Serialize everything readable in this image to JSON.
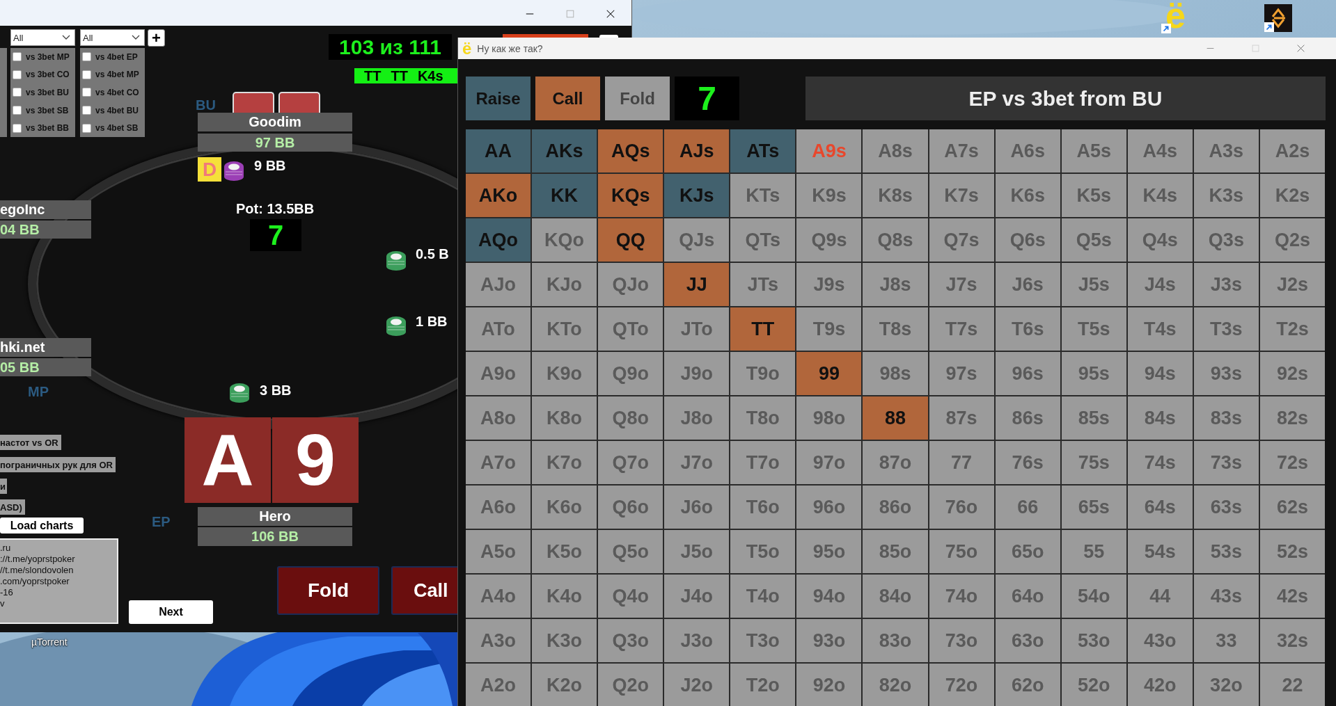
{
  "poker_window": {
    "dropdowns": [
      {
        "value": "All"
      },
      {
        "value": "All"
      }
    ],
    "add_button": "+",
    "checkbox_columns": [
      [
        {
          "label": "vs 3bet MP",
          "checked": false
        },
        {
          "label": "vs 3bet CO",
          "checked": false
        },
        {
          "label": "vs 3bet BU",
          "checked": false
        },
        {
          "label": "vs 3bet SB",
          "checked": false
        },
        {
          "label": "vs 3bet BB",
          "checked": false
        }
      ],
      [
        {
          "label": "vs 4bet EP",
          "checked": false
        },
        {
          "label": "vs 4bet MP",
          "checked": false
        },
        {
          "label": "vs 4bet CO",
          "checked": false
        },
        {
          "label": "vs 4bet BU",
          "checked": false
        },
        {
          "label": "vs 4bet SB",
          "checked": false
        }
      ]
    ],
    "counter": "103 из 111",
    "history": [
      "TT",
      "TT",
      "K4s"
    ],
    "seats": [
      {
        "position": "BU",
        "name": "Goodim",
        "stack": "97 BB"
      },
      {
        "name": "egoInc",
        "stack": "04 BB"
      },
      {
        "position": "MP",
        "name": "hki.net",
        "stack": "05 BB"
      },
      {
        "position": "EP",
        "name": "Hero",
        "stack": "106 BB"
      }
    ],
    "dealer": "D",
    "hero_cards": [
      "A",
      "9"
    ],
    "pot": "Pot: 13.5BB",
    "count": "7",
    "bets": [
      {
        "amount": "9 BB",
        "color": "#9b3fb5"
      },
      {
        "amount": "0.5 B",
        "color": "#3c9e5c"
      },
      {
        "amount": "1 BB",
        "color": "#3c9e5c"
      },
      {
        "amount": "3 BB",
        "color": "#3c9e5c"
      }
    ],
    "side_labels": [
      "настот vs OR",
      "пограничных рук для OR",
      "и",
      "ASD)"
    ],
    "load_button": "Load charts",
    "info_lines": [
      ".ru",
      "://t.me/yoprstpoker",
      "//t.me/slondovolen",
      ".com/yoprstpoker",
      "-16",
      "v"
    ],
    "next_button": "Next",
    "actions": [
      "Fold",
      "Call"
    ]
  },
  "chart_window": {
    "title": "Ну как же так?",
    "app_icon": "ё",
    "legend": [
      {
        "label": "Raise",
        "kind": "raise"
      },
      {
        "label": "Call",
        "kind": "call"
      },
      {
        "label": "Fold",
        "kind": "fold"
      }
    ],
    "count": "7",
    "heading": "EP vs 3bet from BU",
    "grid": [
      [
        {
          "label": "AA",
          "kind": "raise",
          "highlighted": false
        },
        {
          "label": "AKs",
          "kind": "raise",
          "highlighted": false
        },
        {
          "label": "AQs",
          "kind": "call",
          "highlighted": false
        },
        {
          "label": "AJs",
          "kind": "call",
          "highlighted": false
        },
        {
          "label": "ATs",
          "kind": "raise",
          "highlighted": false
        },
        {
          "label": "A9s",
          "kind": "fold",
          "highlighted": true
        },
        {
          "label": "A8s",
          "kind": "fold",
          "highlighted": false
        },
        {
          "label": "A7s",
          "kind": "fold",
          "highlighted": false
        },
        {
          "label": "A6s",
          "kind": "fold",
          "highlighted": false
        },
        {
          "label": "A5s",
          "kind": "fold",
          "highlighted": false
        },
        {
          "label": "A4s",
          "kind": "fold",
          "highlighted": false
        },
        {
          "label": "A3s",
          "kind": "fold",
          "highlighted": false
        },
        {
          "label": "A2s",
          "kind": "fold",
          "highlighted": false
        }
      ],
      [
        {
          "label": "AKo",
          "kind": "call",
          "highlighted": false
        },
        {
          "label": "KK",
          "kind": "raise",
          "highlighted": false
        },
        {
          "label": "KQs",
          "kind": "call",
          "highlighted": false
        },
        {
          "label": "KJs",
          "kind": "raise",
          "highlighted": false
        },
        {
          "label": "KTs",
          "kind": "fold",
          "highlighted": false
        },
        {
          "label": "K9s",
          "kind": "fold",
          "highlighted": false
        },
        {
          "label": "K8s",
          "kind": "fold",
          "highlighted": false
        },
        {
          "label": "K7s",
          "kind": "fold",
          "highlighted": false
        },
        {
          "label": "K6s",
          "kind": "fold",
          "highlighted": false
        },
        {
          "label": "K5s",
          "kind": "fold",
          "highlighted": false
        },
        {
          "label": "K4s",
          "kind": "fold",
          "highlighted": false
        },
        {
          "label": "K3s",
          "kind": "fold",
          "highlighted": false
        },
        {
          "label": "K2s",
          "kind": "fold",
          "highlighted": false
        }
      ],
      [
        {
          "label": "AQo",
          "kind": "raise",
          "highlighted": false
        },
        {
          "label": "KQo",
          "kind": "fold",
          "highlighted": false
        },
        {
          "label": "QQ",
          "kind": "call",
          "highlighted": false
        },
        {
          "label": "QJs",
          "kind": "fold",
          "highlighted": false
        },
        {
          "label": "QTs",
          "kind": "fold",
          "highlighted": false
        },
        {
          "label": "Q9s",
          "kind": "fold",
          "highlighted": false
        },
        {
          "label": "Q8s",
          "kind": "fold",
          "highlighted": false
        },
        {
          "label": "Q7s",
          "kind": "fold",
          "highlighted": false
        },
        {
          "label": "Q6s",
          "kind": "fold",
          "highlighted": false
        },
        {
          "label": "Q5s",
          "kind": "fold",
          "highlighted": false
        },
        {
          "label": "Q4s",
          "kind": "fold",
          "highlighted": false
        },
        {
          "label": "Q3s",
          "kind": "fold",
          "highlighted": false
        },
        {
          "label": "Q2s",
          "kind": "fold",
          "highlighted": false
        }
      ],
      [
        {
          "label": "AJo",
          "kind": "fold",
          "highlighted": false
        },
        {
          "label": "KJo",
          "kind": "fold",
          "highlighted": false
        },
        {
          "label": "QJo",
          "kind": "fold",
          "highlighted": false
        },
        {
          "label": "JJ",
          "kind": "call",
          "highlighted": false
        },
        {
          "label": "JTs",
          "kind": "fold",
          "highlighted": false
        },
        {
          "label": "J9s",
          "kind": "fold",
          "highlighted": false
        },
        {
          "label": "J8s",
          "kind": "fold",
          "highlighted": false
        },
        {
          "label": "J7s",
          "kind": "fold",
          "highlighted": false
        },
        {
          "label": "J6s",
          "kind": "fold",
          "highlighted": false
        },
        {
          "label": "J5s",
          "kind": "fold",
          "highlighted": false
        },
        {
          "label": "J4s",
          "kind": "fold",
          "highlighted": false
        },
        {
          "label": "J3s",
          "kind": "fold",
          "highlighted": false
        },
        {
          "label": "J2s",
          "kind": "fold",
          "highlighted": false
        }
      ],
      [
        {
          "label": "ATo",
          "kind": "fold",
          "highlighted": false
        },
        {
          "label": "KTo",
          "kind": "fold",
          "highlighted": false
        },
        {
          "label": "QTo",
          "kind": "fold",
          "highlighted": false
        },
        {
          "label": "JTo",
          "kind": "fold",
          "highlighted": false
        },
        {
          "label": "TT",
          "kind": "call",
          "highlighted": false
        },
        {
          "label": "T9s",
          "kind": "fold",
          "highlighted": false
        },
        {
          "label": "T8s",
          "kind": "fold",
          "highlighted": false
        },
        {
          "label": "T7s",
          "kind": "fold",
          "highlighted": false
        },
        {
          "label": "T6s",
          "kind": "fold",
          "highlighted": false
        },
        {
          "label": "T5s",
          "kind": "fold",
          "highlighted": false
        },
        {
          "label": "T4s",
          "kind": "fold",
          "highlighted": false
        },
        {
          "label": "T3s",
          "kind": "fold",
          "highlighted": false
        },
        {
          "label": "T2s",
          "kind": "fold",
          "highlighted": false
        }
      ],
      [
        {
          "label": "A9o",
          "kind": "fold",
          "highlighted": false
        },
        {
          "label": "K9o",
          "kind": "fold",
          "highlighted": false
        },
        {
          "label": "Q9o",
          "kind": "fold",
          "highlighted": false
        },
        {
          "label": "J9o",
          "kind": "fold",
          "highlighted": false
        },
        {
          "label": "T9o",
          "kind": "fold",
          "highlighted": false
        },
        {
          "label": "99",
          "kind": "call",
          "highlighted": false
        },
        {
          "label": "98s",
          "kind": "fold",
          "highlighted": false
        },
        {
          "label": "97s",
          "kind": "fold",
          "highlighted": false
        },
        {
          "label": "96s",
          "kind": "fold",
          "highlighted": false
        },
        {
          "label": "95s",
          "kind": "fold",
          "highlighted": false
        },
        {
          "label": "94s",
          "kind": "fold",
          "highlighted": false
        },
        {
          "label": "93s",
          "kind": "fold",
          "highlighted": false
        },
        {
          "label": "92s",
          "kind": "fold",
          "highlighted": false
        }
      ],
      [
        {
          "label": "A8o",
          "kind": "fold",
          "highlighted": false
        },
        {
          "label": "K8o",
          "kind": "fold",
          "highlighted": false
        },
        {
          "label": "Q8o",
          "kind": "fold",
          "highlighted": false
        },
        {
          "label": "J8o",
          "kind": "fold",
          "highlighted": false
        },
        {
          "label": "T8o",
          "kind": "fold",
          "highlighted": false
        },
        {
          "label": "98o",
          "kind": "fold",
          "highlighted": false
        },
        {
          "label": "88",
          "kind": "call",
          "highlighted": false
        },
        {
          "label": "87s",
          "kind": "fold",
          "highlighted": false
        },
        {
          "label": "86s",
          "kind": "fold",
          "highlighted": false
        },
        {
          "label": "85s",
          "kind": "fold",
          "highlighted": false
        },
        {
          "label": "84s",
          "kind": "fold",
          "highlighted": false
        },
        {
          "label": "83s",
          "kind": "fold",
          "highlighted": false
        },
        {
          "label": "82s",
          "kind": "fold",
          "highlighted": false
        }
      ],
      [
        {
          "label": "A7o",
          "kind": "fold",
          "highlighted": false
        },
        {
          "label": "K7o",
          "kind": "fold",
          "highlighted": false
        },
        {
          "label": "Q7o",
          "kind": "fold",
          "highlighted": false
        },
        {
          "label": "J7o",
          "kind": "fold",
          "highlighted": false
        },
        {
          "label": "T7o",
          "kind": "fold",
          "highlighted": false
        },
        {
          "label": "97o",
          "kind": "fold",
          "highlighted": false
        },
        {
          "label": "87o",
          "kind": "fold",
          "highlighted": false
        },
        {
          "label": "77",
          "kind": "fold",
          "highlighted": false
        },
        {
          "label": "76s",
          "kind": "fold",
          "highlighted": false
        },
        {
          "label": "75s",
          "kind": "fold",
          "highlighted": false
        },
        {
          "label": "74s",
          "kind": "fold",
          "highlighted": false
        },
        {
          "label": "73s",
          "kind": "fold",
          "highlighted": false
        },
        {
          "label": "72s",
          "kind": "fold",
          "highlighted": false
        }
      ],
      [
        {
          "label": "A6o",
          "kind": "fold",
          "highlighted": false
        },
        {
          "label": "K6o",
          "kind": "fold",
          "highlighted": false
        },
        {
          "label": "Q6o",
          "kind": "fold",
          "highlighted": false
        },
        {
          "label": "J6o",
          "kind": "fold",
          "highlighted": false
        },
        {
          "label": "T6o",
          "kind": "fold",
          "highlighted": false
        },
        {
          "label": "96o",
          "kind": "fold",
          "highlighted": false
        },
        {
          "label": "86o",
          "kind": "fold",
          "highlighted": false
        },
        {
          "label": "76o",
          "kind": "fold",
          "highlighted": false
        },
        {
          "label": "66",
          "kind": "fold",
          "highlighted": false
        },
        {
          "label": "65s",
          "kind": "fold",
          "highlighted": false
        },
        {
          "label": "64s",
          "kind": "fold",
          "highlighted": false
        },
        {
          "label": "63s",
          "kind": "fold",
          "highlighted": false
        },
        {
          "label": "62s",
          "kind": "fold",
          "highlighted": false
        }
      ],
      [
        {
          "label": "A5o",
          "kind": "fold",
          "highlighted": false
        },
        {
          "label": "K5o",
          "kind": "fold",
          "highlighted": false
        },
        {
          "label": "Q5o",
          "kind": "fold",
          "highlighted": false
        },
        {
          "label": "J5o",
          "kind": "fold",
          "highlighted": false
        },
        {
          "label": "T5o",
          "kind": "fold",
          "highlighted": false
        },
        {
          "label": "95o",
          "kind": "fold",
          "highlighted": false
        },
        {
          "label": "85o",
          "kind": "fold",
          "highlighted": false
        },
        {
          "label": "75o",
          "kind": "fold",
          "highlighted": false
        },
        {
          "label": "65o",
          "kind": "fold",
          "highlighted": false
        },
        {
          "label": "55",
          "kind": "fold",
          "highlighted": false
        },
        {
          "label": "54s",
          "kind": "fold",
          "highlighted": false
        },
        {
          "label": "53s",
          "kind": "fold",
          "highlighted": false
        },
        {
          "label": "52s",
          "kind": "fold",
          "highlighted": false
        }
      ],
      [
        {
          "label": "A4o",
          "kind": "fold",
          "highlighted": false
        },
        {
          "label": "K4o",
          "kind": "fold",
          "highlighted": false
        },
        {
          "label": "Q4o",
          "kind": "fold",
          "highlighted": false
        },
        {
          "label": "J4o",
          "kind": "fold",
          "highlighted": false
        },
        {
          "label": "T4o",
          "kind": "fold",
          "highlighted": false
        },
        {
          "label": "94o",
          "kind": "fold",
          "highlighted": false
        },
        {
          "label": "84o",
          "kind": "fold",
          "highlighted": false
        },
        {
          "label": "74o",
          "kind": "fold",
          "highlighted": false
        },
        {
          "label": "64o",
          "kind": "fold",
          "highlighted": false
        },
        {
          "label": "54o",
          "kind": "fold",
          "highlighted": false
        },
        {
          "label": "44",
          "kind": "fold",
          "highlighted": false
        },
        {
          "label": "43s",
          "kind": "fold",
          "highlighted": false
        },
        {
          "label": "42s",
          "kind": "fold",
          "highlighted": false
        }
      ],
      [
        {
          "label": "A3o",
          "kind": "fold",
          "highlighted": false
        },
        {
          "label": "K3o",
          "kind": "fold",
          "highlighted": false
        },
        {
          "label": "Q3o",
          "kind": "fold",
          "highlighted": false
        },
        {
          "label": "J3o",
          "kind": "fold",
          "highlighted": false
        },
        {
          "label": "T3o",
          "kind": "fold",
          "highlighted": false
        },
        {
          "label": "93o",
          "kind": "fold",
          "highlighted": false
        },
        {
          "label": "83o",
          "kind": "fold",
          "highlighted": false
        },
        {
          "label": "73o",
          "kind": "fold",
          "highlighted": false
        },
        {
          "label": "63o",
          "kind": "fold",
          "highlighted": false
        },
        {
          "label": "53o",
          "kind": "fold",
          "highlighted": false
        },
        {
          "label": "43o",
          "kind": "fold",
          "highlighted": false
        },
        {
          "label": "33",
          "kind": "fold",
          "highlighted": false
        },
        {
          "label": "32s",
          "kind": "fold",
          "highlighted": false
        }
      ],
      [
        {
          "label": "A2o",
          "kind": "fold",
          "highlighted": false
        },
        {
          "label": "K2o",
          "kind": "fold",
          "highlighted": false
        },
        {
          "label": "Q2o",
          "kind": "fold",
          "highlighted": false
        },
        {
          "label": "J2o",
          "kind": "fold",
          "highlighted": false
        },
        {
          "label": "T2o",
          "kind": "fold",
          "highlighted": false
        },
        {
          "label": "92o",
          "kind": "fold",
          "highlighted": false
        },
        {
          "label": "82o",
          "kind": "fold",
          "highlighted": false
        },
        {
          "label": "72o",
          "kind": "fold",
          "highlighted": false
        },
        {
          "label": "62o",
          "kind": "fold",
          "highlighted": false
        },
        {
          "label": "52o",
          "kind": "fold",
          "highlighted": false
        },
        {
          "label": "42o",
          "kind": "fold",
          "highlighted": false
        },
        {
          "label": "32o",
          "kind": "fold",
          "highlighted": false
        },
        {
          "label": "22",
          "kind": "fold",
          "highlighted": false
        }
      ]
    ]
  },
  "desktop": {
    "shortcut_glyph": "ё",
    "icon_labels": [
      "µTorrent"
    ]
  }
}
